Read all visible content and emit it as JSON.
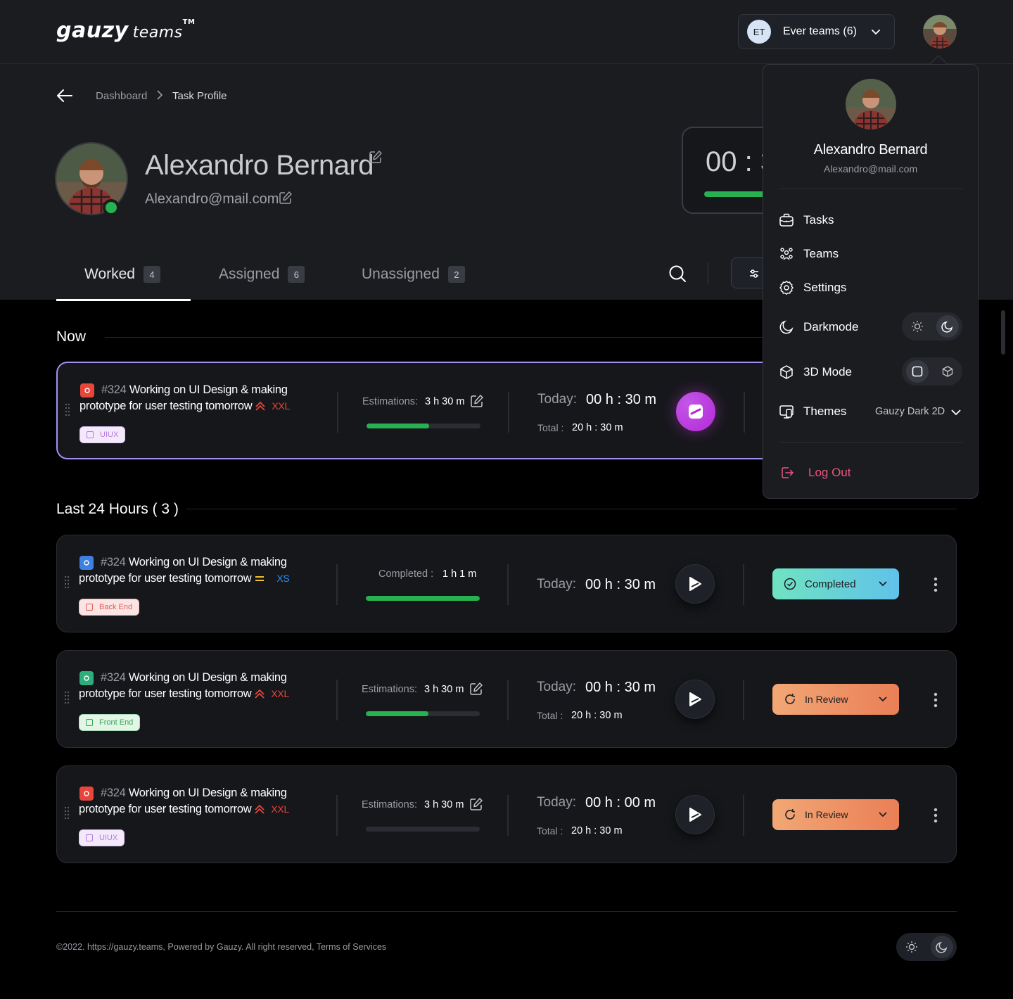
{
  "brand": {
    "name": "gauzy",
    "sub": "teams",
    "tm": "TM"
  },
  "team_switcher": {
    "badge": "ET",
    "label": "Ever teams (6)"
  },
  "breadcrumb": {
    "home": "Dashboard",
    "current": "Task Profile"
  },
  "profile": {
    "name": "Alexandro Bernard",
    "email": "Alexandro@mail.com",
    "timer": "00 : 3"
  },
  "tabs": [
    {
      "label": "Worked",
      "count": "4"
    },
    {
      "label": "Assigned",
      "count": "6"
    },
    {
      "label": "Unassigned",
      "count": "2"
    }
  ],
  "sections": {
    "now": "Now",
    "last24": "Last 24 Hours ( 3 )"
  },
  "tasks": [
    {
      "number": "#324",
      "title": "Working on UI Design & making prototype for user testing tomorrow",
      "size": "XXL",
      "size_color": "#e8463a",
      "priority": "high",
      "tag": "UIUX",
      "tag_color": "#b17be0",
      "metric_label": "Estimations:",
      "metric_value": "3 h 30 m",
      "progress": 0.55,
      "today_label": "Today:",
      "today": "00 h : 30 m",
      "total_label": "Total :",
      "total": "20 h : 30 m",
      "icon_color": "#e8463a"
    },
    {
      "number": "#324",
      "title": "Working on UI Design & making prototype for user testing tomorrow",
      "size": "XS",
      "size_color": "#2f8cf5",
      "priority": "medium",
      "tag": "Back End",
      "tag_color": "#e25b57",
      "metric_label": "Completed :",
      "metric_value": "1 h 1 m",
      "progress": 1.0,
      "today_label": "Today:",
      "today": "00 h : 30 m",
      "status": "Completed",
      "icon_color": "#3e7fe0"
    },
    {
      "number": "#324",
      "title": "Working on UI Design & making prototype for user testing tomorrow",
      "size": "XXL",
      "size_color": "#e8463a",
      "priority": "high",
      "tag": "Front End",
      "tag_color": "#34a853",
      "metric_label": "Estimations:",
      "metric_value": "3 h 30 m",
      "progress": 0.55,
      "today_label": "Today:",
      "today": "00 h : 30 m",
      "total_label": "Total :",
      "total": "20 h : 30 m",
      "status": "In Review",
      "icon_color": "#2fae7d"
    },
    {
      "number": "#324",
      "title": "Working on UI Design & making prototype for user testing tomorrow",
      "size": "XXL",
      "size_color": "#e8463a",
      "priority": "high",
      "tag": "UIUX",
      "tag_color": "#b17be0",
      "metric_label": "Estimations:",
      "metric_value": "3 h 30 m",
      "progress": 0.0,
      "today_label": "Today:",
      "today": "00 h : 00 m",
      "total_label": "Total :",
      "total": "20 h : 30 m",
      "status": "In Review",
      "icon_color": "#e8463a"
    }
  ],
  "footer": {
    "text": "©2022. https://gauzy.teams, Powered by Gauzy. All right reserved, Terms of Services"
  },
  "menu": {
    "name": "Alexandro Bernard",
    "email": "Alexandro@mail.com",
    "items": {
      "tasks": "Tasks",
      "teams": "Teams",
      "settings": "Settings",
      "darkmode": "Darkmode",
      "mode3d": "3D Mode",
      "themes": "Themes"
    },
    "theme_value": "Gauzy Dark 2D",
    "logout": "Log Out"
  },
  "colors": {
    "accent": "#a38ff0",
    "green": "#27b150",
    "logout": "#e8567f",
    "background": "#000000",
    "panel": "#1b1c20"
  },
  "icons": [
    "back-arrow-icon",
    "chevron-right-icon",
    "edit-icon",
    "search-icon",
    "filter-icon",
    "play-icon",
    "priority-icon",
    "kebab-icon",
    "briefcase-icon",
    "people-icon",
    "gear-icon",
    "moon-icon",
    "sun-icon",
    "cube-icon",
    "themes-icon",
    "logout-icon",
    "check-circle-icon",
    "review-icon"
  ]
}
